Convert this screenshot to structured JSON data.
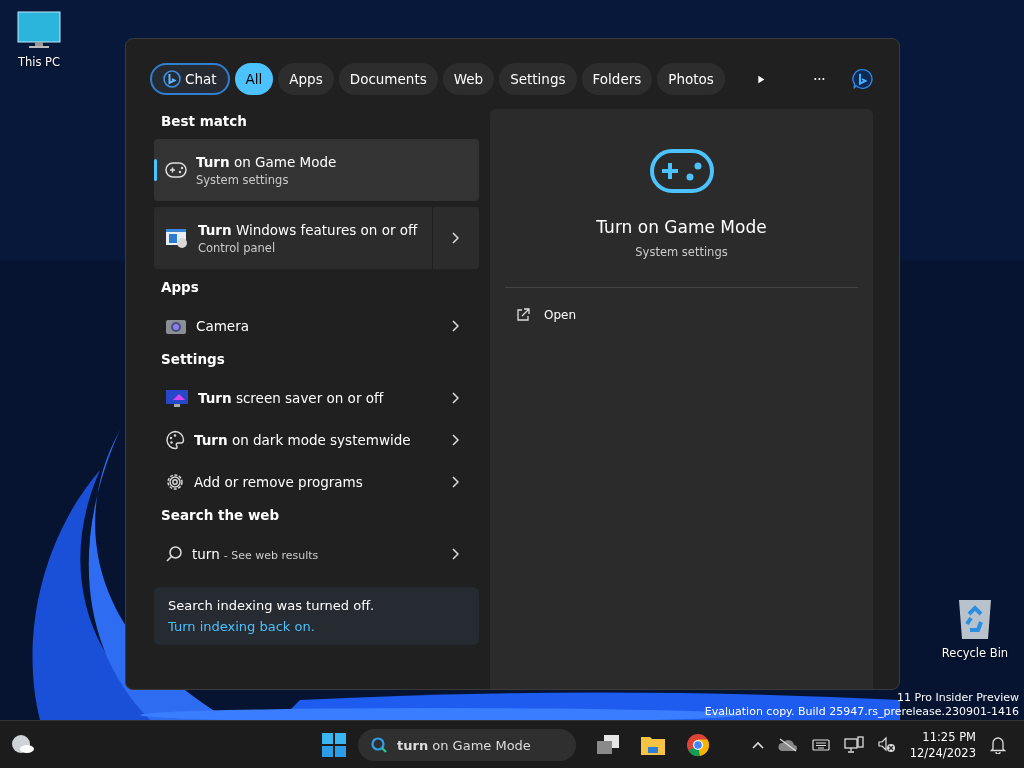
{
  "desktop_icons": [
    {
      "label": "This PC",
      "kind": "pc"
    },
    {
      "label": "Recycle Bin",
      "kind": "bin"
    }
  ],
  "watermark": [
    "11 Pro Insider Preview",
    "Evaluation copy. Build 25947.rs_prerelease.230901-1416"
  ],
  "search_panel": {
    "filters": [
      {
        "label": "Chat",
        "kind": "chat",
        "selected": false
      },
      {
        "label": "All",
        "kind": "pill",
        "selected": true
      },
      {
        "label": "Apps",
        "kind": "pill",
        "selected": false
      },
      {
        "label": "Documents",
        "kind": "pill",
        "selected": false
      },
      {
        "label": "Web",
        "kind": "pill",
        "selected": false
      },
      {
        "label": "Settings",
        "kind": "pill",
        "selected": false
      },
      {
        "label": "Folders",
        "kind": "pill",
        "selected": false
      },
      {
        "label": "Photos",
        "kind": "pill",
        "selected": false
      }
    ],
    "sections": [
      {
        "title": "Best match",
        "items": [
          {
            "kind": "card",
            "text": "**Turn** on Game Mode",
            "subtitle": "System settings",
            "selected": true,
            "has_arrow": false
          },
          {
            "kind": "card",
            "text": "**Turn** Windows features on or off",
            "subtitle": "Control panel",
            "selected": false,
            "has_arrow": true
          }
        ]
      },
      {
        "title": "Apps",
        "items": [
          {
            "kind": "row",
            "text": "Camera",
            "selected": false,
            "has_arrow": true
          }
        ]
      },
      {
        "title": "Settings",
        "items": [
          {
            "kind": "row",
            "text": "**Turn** screen saver on or off",
            "selected": false,
            "has_arrow": true
          },
          {
            "kind": "row",
            "text": "**Turn** on dark mode systemwide",
            "selected": false,
            "has_arrow": true
          },
          {
            "kind": "row",
            "text": "Add or remove programs",
            "selected": false,
            "has_arrow": true
          }
        ]
      },
      {
        "title": "Search the web",
        "items": [
          {
            "kind": "web",
            "text": "turn",
            "hint": "- See web results",
            "selected": false,
            "has_arrow": true
          }
        ]
      }
    ],
    "notice": {
      "text": "Search indexing was turned off.",
      "link": "Turn indexing back on."
    },
    "preview": {
      "title": "Turn on Game Mode",
      "subtitle": "System settings",
      "actions": [
        {
          "label": "Open"
        }
      ]
    }
  },
  "taskbar": {
    "search_value": "**turn** on Game Mode",
    "time": "11:25 PM",
    "date": "12/24/2023"
  }
}
